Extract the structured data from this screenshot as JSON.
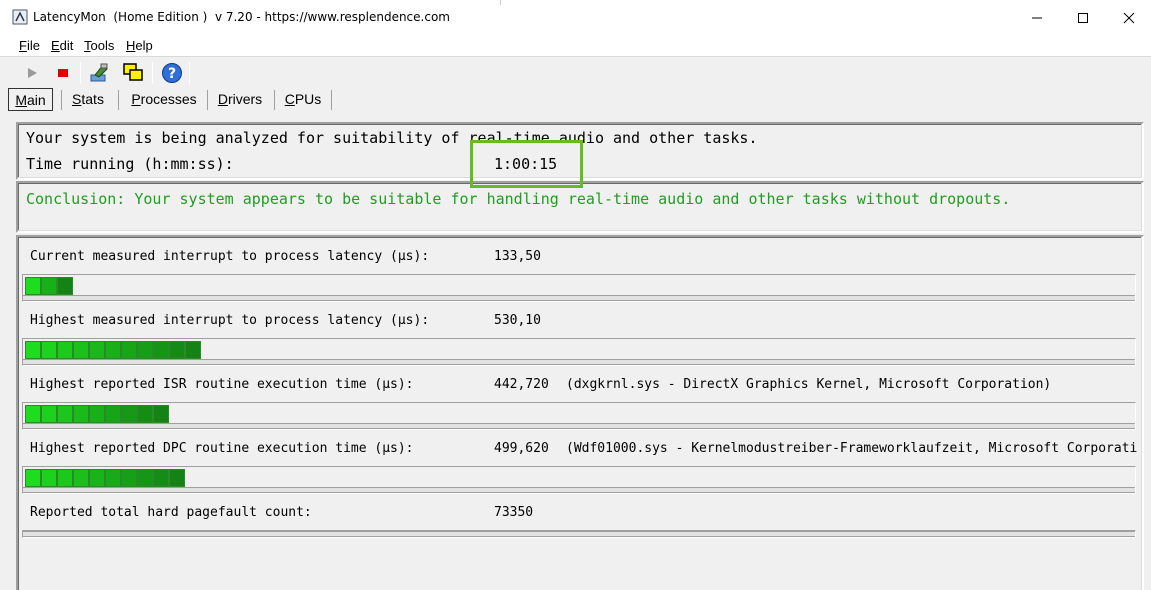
{
  "window": {
    "title": "LatencyMon  (Home Edition )  v 7.20 - https://www.resplendence.com",
    "minimize": "─",
    "maximize": "☐",
    "close": "✕"
  },
  "menu": [
    "File",
    "Edit",
    "Tools",
    "Help"
  ],
  "toolbar": {
    "icons": [
      "play-icon",
      "stop-icon",
      "tools-icon",
      "cpu-windows-icon",
      "help-icon"
    ]
  },
  "tabs": [
    "Main",
    "Stats",
    "Processes",
    "Drivers",
    "CPUs"
  ],
  "status": {
    "analyzing": "Your system is being analyzed for suitability of real-time audio and other tasks.",
    "time_label": "Time running (h:mm:ss):",
    "time_value": "1:00:15",
    "conclusion": "Conclusion: Your system appears to be suitable for handling real-time audio and other tasks without dropouts."
  },
  "metrics": [
    {
      "label": "Current measured interrupt to process latency (µs):",
      "value": "133,50",
      "detail": "",
      "segments": 3
    },
    {
      "label": "Highest measured interrupt to process latency (µs):",
      "value": "530,10",
      "detail": "",
      "segments": 11
    },
    {
      "label": "Highest reported ISR routine execution time (µs):",
      "value": "442,720",
      "detail": "(dxgkrnl.sys - DirectX Graphics Kernel, Microsoft Corporation)",
      "segments": 9
    },
    {
      "label": "Highest reported DPC routine execution time (µs):",
      "value": "499,620",
      "detail": "(Wdf01000.sys - Kernelmodustreiber-Frameworklaufzeit, Microsoft Corporati",
      "segments": 10
    },
    {
      "label": "Reported total hard pagefault count:",
      "value": "73350",
      "detail": "",
      "segments": 0
    }
  ],
  "colors": {
    "accent_green": "#1f9e1f",
    "highlight": "#66bb22",
    "bar_green": "#22cc22"
  }
}
